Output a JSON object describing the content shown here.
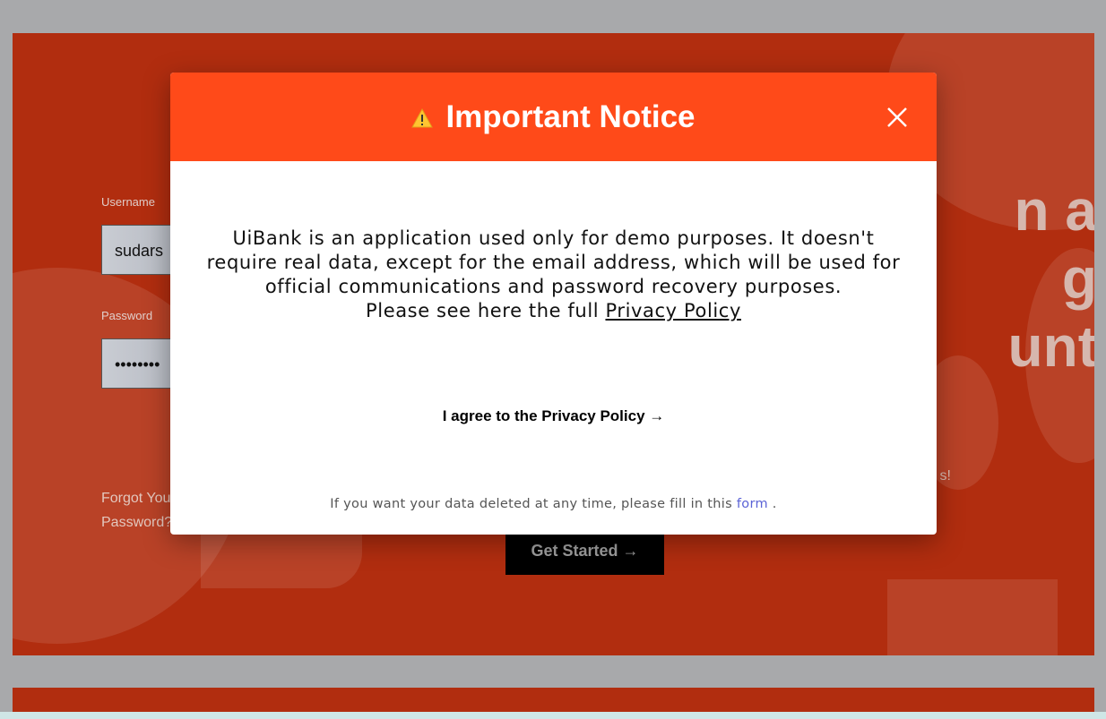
{
  "background": {
    "username_label": "Username",
    "username_value": "sudars",
    "password_label": "Password",
    "password_value": "••••••••",
    "forgot_text": "Forgot Your Password?",
    "heading_text": "n a\ng\nunt",
    "subtext": "s!",
    "get_started_label": "Get Started →"
  },
  "modal": {
    "title": "Important Notice",
    "warning_icon": "warning-triangle-icon",
    "close_icon": "close-icon",
    "body_text": "UiBank is an application used only for demo purposes. It doesn't require real data, except for the email address, which will be used for official communications and password recovery purposes.",
    "policy_prefix": "Please see here the full ",
    "policy_link": "Privacy Policy",
    "agree_label": "I agree to the Privacy Policy →",
    "delete_prefix": "If you want your data deleted at any time, please fill in this ",
    "delete_link": "form",
    "delete_suffix": " ."
  },
  "colors": {
    "header": "#ff4a19",
    "hero": "#b12d0f",
    "link": "#5b63d6"
  }
}
